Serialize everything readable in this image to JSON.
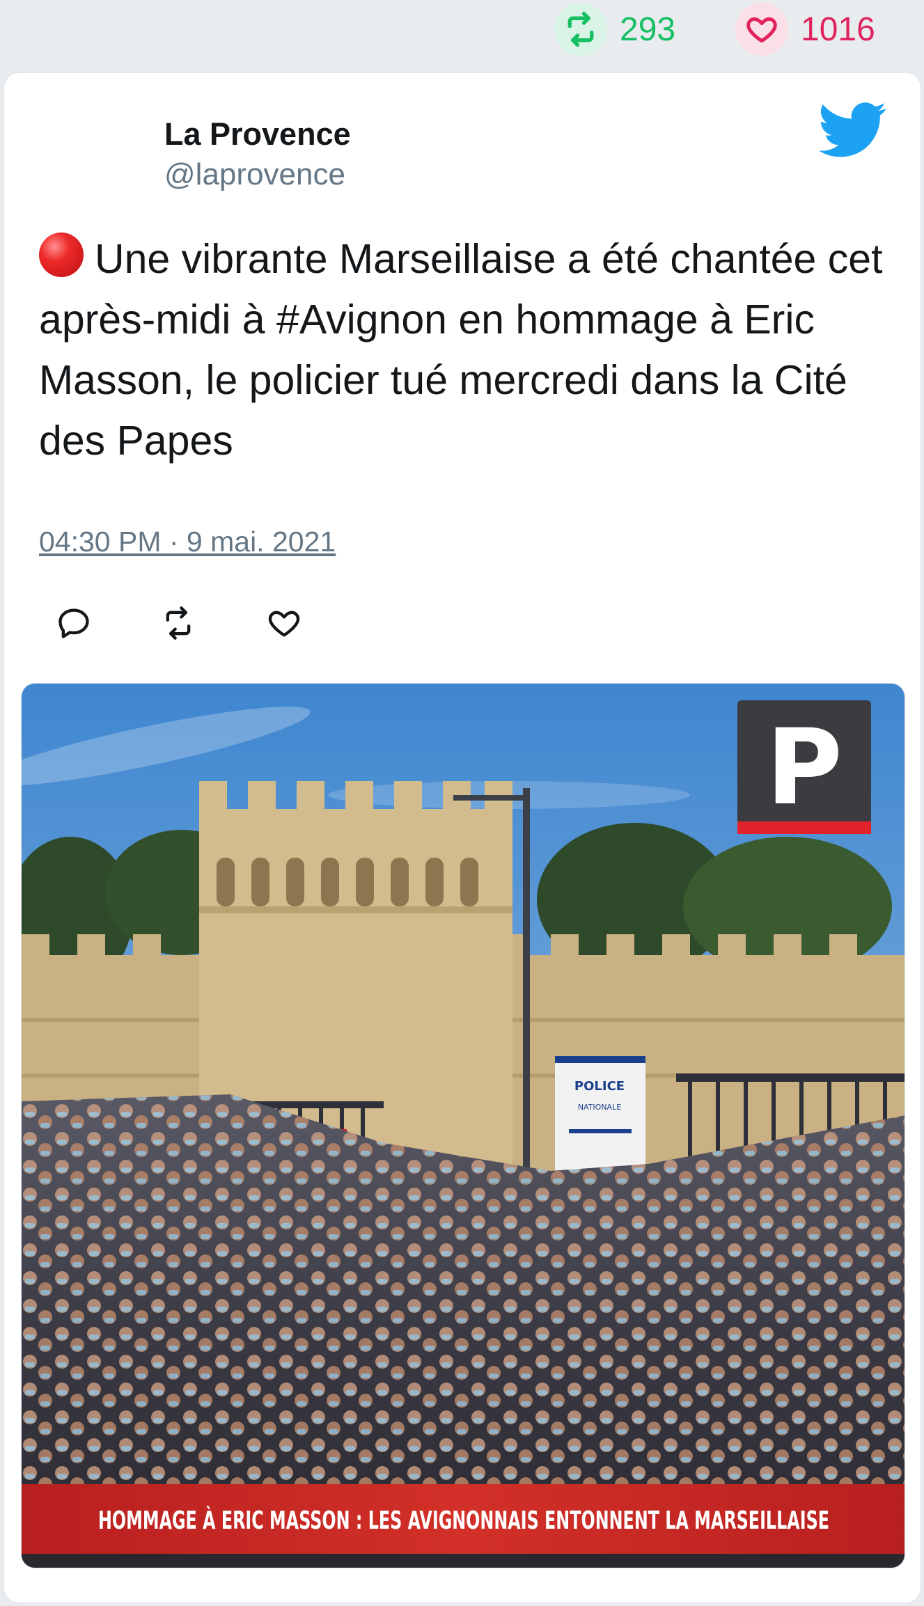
{
  "stats": {
    "retweet_count": "293",
    "like_count": "1016",
    "retweet_icon": "retweet-icon",
    "like_icon": "heart-icon"
  },
  "tweet": {
    "author_name": "La Provence",
    "author_handle": "@laprovence",
    "text": "Une vibrante Marseillaise a été chantée cet après-midi à #Avignon en hommage à Eric Masson, le policier tué mercredi dans la Cité des Papes",
    "timestamp": "04:30 PM · 9 mai. 2021",
    "platform_icon": "twitter-bird-icon",
    "actions": [
      "reply-icon",
      "retweet-icon",
      "heart-icon"
    ]
  },
  "media": {
    "logo_letter": "P",
    "sign_line1": "POLICE",
    "sign_line2": "NATIONALE",
    "banner_text": "HOMMAGE À ERIC MASSON : LES AVIGNONNAIS ENTONNENT LA MARSEILLAISE"
  },
  "colors": {
    "retweet_green": "#17bf63",
    "like_red": "#e0245e",
    "twitter_blue": "#1da1f2",
    "muted": "#657786"
  }
}
